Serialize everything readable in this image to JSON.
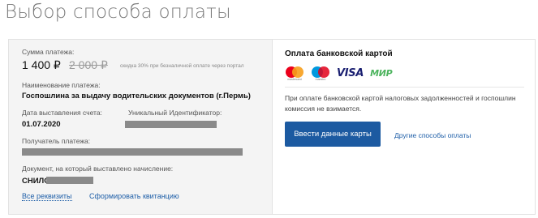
{
  "page": {
    "title": "Выбор способа оплаты"
  },
  "payment": {
    "amount_label": "Сумма платежа:",
    "amount": "1 400 ₽",
    "old_amount": "2 000 ₽",
    "discount_note": "скидка 30% при безналичной оплате через портал",
    "name_label": "Наименование платежа:",
    "name_value": "Госпошлина за выдачу водительских документов (г.Пермь)",
    "date_label": "Дата выставления счета:",
    "date_value": "01.07.2020",
    "uid_label": "Уникальный Идентификатор:",
    "recipient_label": "Получатель платежа:",
    "document_label": "Документ, на который выставлено начисление:",
    "document_value": "СНИЛС",
    "all_details_link": "Все реквизиты",
    "receipt_link": "Сформировать квитанцию"
  },
  "card_payment": {
    "title": "Оплата банковской картой",
    "logos": [
      {
        "icon": "mastercard-icon",
        "caption": "mastercard"
      },
      {
        "icon": "maestro-icon",
        "caption": "maestro"
      },
      {
        "icon": "visa-icon",
        "text": "VISA"
      },
      {
        "icon": "mir-icon",
        "text": "МИР"
      }
    ],
    "note": "При оплате банковской картой налоговых задолженностей и госпошлин комиссия не взимается.",
    "pay_button": "Ввести данные карты",
    "other_methods_link": "Другие способы оплаты"
  },
  "colors": {
    "accent": "#1c5aa1",
    "link": "#1f5fa8",
    "panel_left_bg": "#f4f4f4",
    "redaction": "#8a8a8a"
  }
}
